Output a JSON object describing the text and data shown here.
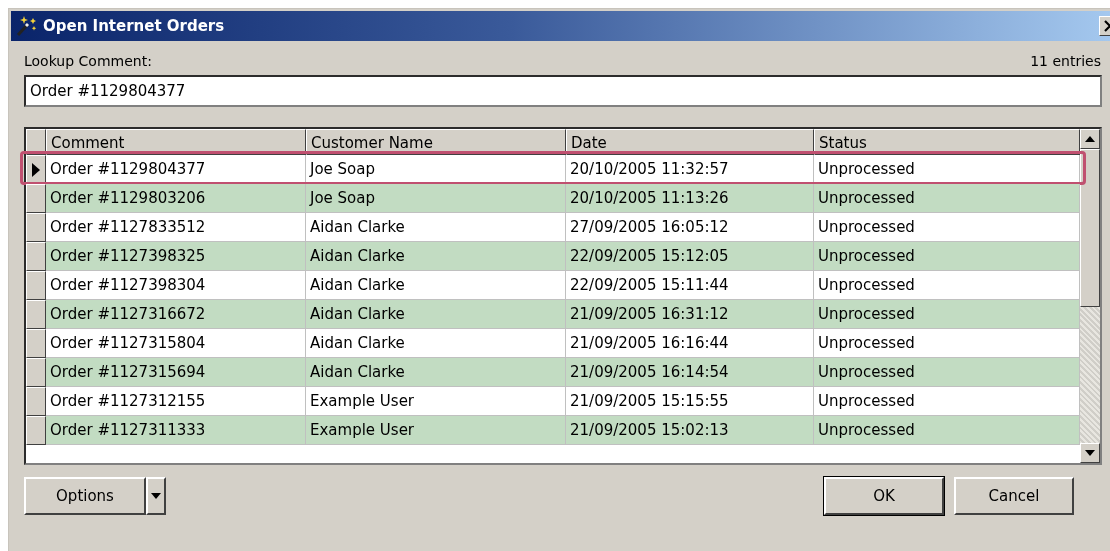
{
  "window": {
    "title": "Open Internet Orders"
  },
  "lookup": {
    "label": "Lookup Comment:",
    "value": "Order #1129804377",
    "count": "11 entries"
  },
  "table": {
    "columns": [
      "Comment",
      "Customer Name",
      "Date",
      "Status"
    ],
    "rows": [
      {
        "cells": [
          "Order #1129804377",
          "Joe Soap",
          "20/10/2005 11:32:57",
          "Unprocessed"
        ],
        "selected": true
      },
      {
        "cells": [
          "Order #1129803206",
          "Joe Soap",
          "20/10/2005 11:13:26",
          "Unprocessed"
        ],
        "selected": false
      },
      {
        "cells": [
          "Order #1127833512",
          "Aidan Clarke",
          "27/09/2005 16:05:12",
          "Unprocessed"
        ],
        "selected": false
      },
      {
        "cells": [
          "Order #1127398325",
          "Aidan Clarke",
          "22/09/2005 15:12:05",
          "Unprocessed"
        ],
        "selected": false
      },
      {
        "cells": [
          "Order #1127398304",
          "Aidan Clarke",
          "22/09/2005 15:11:44",
          "Unprocessed"
        ],
        "selected": false
      },
      {
        "cells": [
          "Order #1127316672",
          "Aidan Clarke",
          "21/09/2005 16:31:12",
          "Unprocessed"
        ],
        "selected": false
      },
      {
        "cells": [
          "Order #1127315804",
          "Aidan Clarke",
          "21/09/2005 16:16:44",
          "Unprocessed"
        ],
        "selected": false
      },
      {
        "cells": [
          "Order #1127315694",
          "Aidan Clarke",
          "21/09/2005 16:14:54",
          "Unprocessed"
        ],
        "selected": false
      },
      {
        "cells": [
          "Order #1127312155",
          "Example User",
          "21/09/2005 15:15:55",
          "Unprocessed"
        ],
        "selected": false
      },
      {
        "cells": [
          "Order #1127311333",
          "Example User",
          "21/09/2005 15:02:13",
          "Unprocessed"
        ],
        "selected": false
      }
    ]
  },
  "buttons": {
    "options": "Options",
    "ok": "OK",
    "cancel": "Cancel"
  }
}
